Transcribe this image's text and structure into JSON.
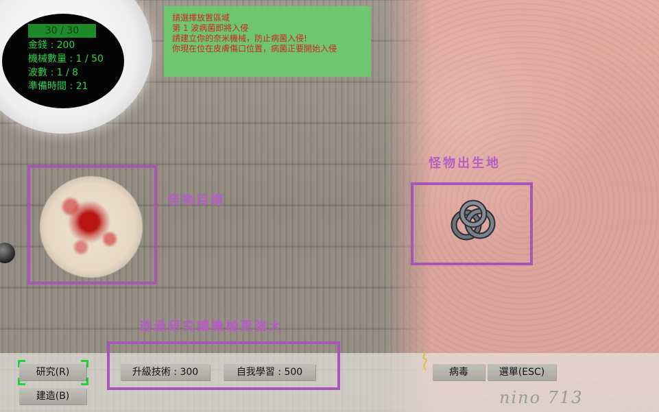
{
  "hud": {
    "hp_text": "30 / 30",
    "lines": [
      "金錢 : 200",
      "機械數量 : 1 / 50",
      "波數 : 1 / 8",
      "準備時間 : 21"
    ]
  },
  "message": {
    "lines": [
      "請選擇放置區域",
      "第 1 波病菌即將入侵",
      "請建立你的奈米機械，防止病菌入侵!",
      "你現在位在皮膚傷口位置，病菌正要開始入侵"
    ]
  },
  "labels": {
    "spawn": "怪物出生地",
    "target": "怪物目標",
    "research_tip": "透過研究讓機械更強大"
  },
  "buttons": {
    "research": "研究(R)",
    "build": "建造(B)",
    "upgrade": "升級技術 : 300",
    "self_learning": "自我學習 : 500",
    "virus": "病毒",
    "menu": "選單(ESC)"
  },
  "signature": "nino 713",
  "colors": {
    "hud_text": "#2cd24a",
    "message_text": "#cf1e1e",
    "highlight_purple": "#a855b8"
  },
  "icons": {
    "spawn": "knot-monster-icon",
    "target": "blood-cell-icon"
  }
}
